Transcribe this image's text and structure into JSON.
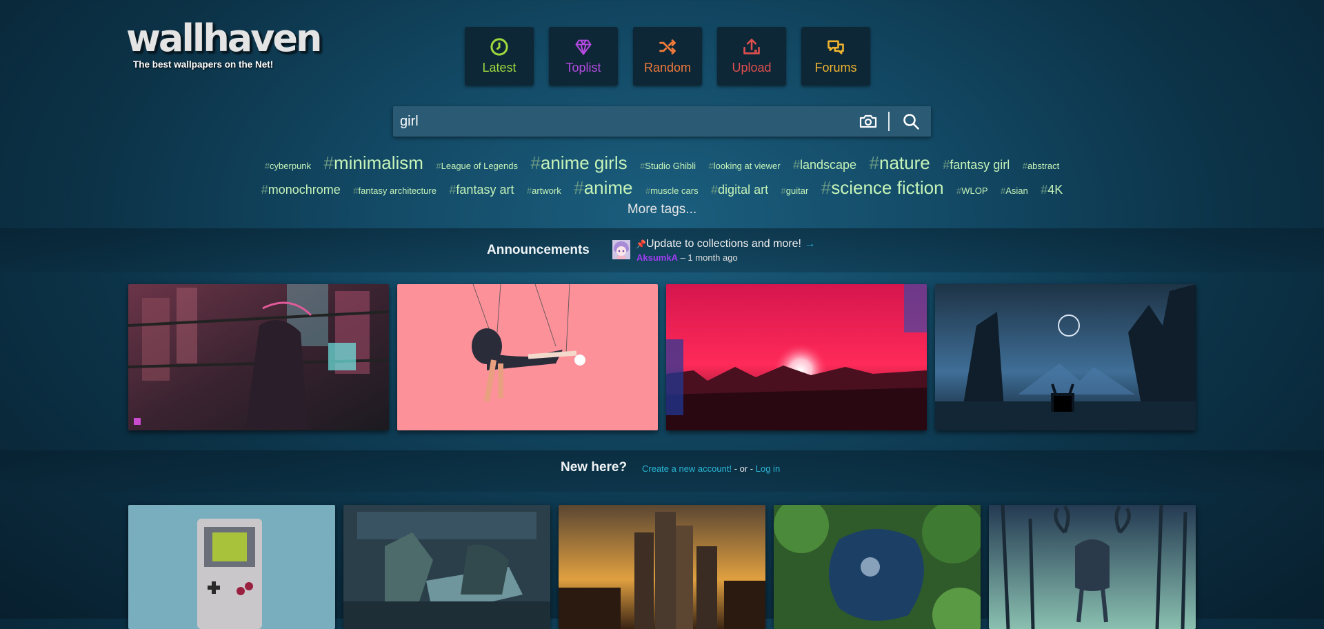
{
  "logo": {
    "name": "wallhaven",
    "tagline": "The best wallpapers on the Net!"
  },
  "nav": [
    {
      "label": "Latest",
      "color": "#9ed93d"
    },
    {
      "label": "Toplist",
      "color": "#b44ae0"
    },
    {
      "label": "Random",
      "color": "#f07a3a"
    },
    {
      "label": "Upload",
      "color": "#e04f4f"
    },
    {
      "label": "Forums",
      "color": "#f0b430"
    }
  ],
  "search": {
    "value": "girl"
  },
  "tags": {
    "row1": [
      {
        "name": "cyberpunk",
        "size": "s"
      },
      {
        "name": "minimalism",
        "size": "l"
      },
      {
        "name": "League of Legends",
        "size": "s"
      },
      {
        "name": "anime girls",
        "size": "l"
      },
      {
        "name": "Studio Ghibli",
        "size": "s"
      },
      {
        "name": "looking at viewer",
        "size": "s"
      },
      {
        "name": "landscape",
        "size": "m"
      },
      {
        "name": "nature",
        "size": "l"
      },
      {
        "name": "fantasy girl",
        "size": "m"
      },
      {
        "name": "abstract",
        "size": "s"
      }
    ],
    "row2": [
      {
        "name": "monochrome",
        "size": "m"
      },
      {
        "name": "fantasy architecture",
        "size": "s"
      },
      {
        "name": "fantasy art",
        "size": "m"
      },
      {
        "name": "artwork",
        "size": "s"
      },
      {
        "name": "anime",
        "size": "l"
      },
      {
        "name": "muscle cars",
        "size": "s"
      },
      {
        "name": "digital art",
        "size": "m"
      },
      {
        "name": "guitar",
        "size": "s"
      },
      {
        "name": "science fiction",
        "size": "l"
      },
      {
        "name": "WLOP",
        "size": "s"
      },
      {
        "name": "Asian",
        "size": "s"
      },
      {
        "name": "4K",
        "size": "m"
      }
    ],
    "more": "More tags..."
  },
  "announcements": {
    "title": "Announcements",
    "pin": "📌",
    "text": "Update to collections and more!",
    "arrow": "→",
    "user": "AksumkA",
    "time": "– 1 month ago"
  },
  "newhere": {
    "title": "New here?",
    "create": "Create a new account!",
    "or": " - or - ",
    "login": "Log in"
  }
}
